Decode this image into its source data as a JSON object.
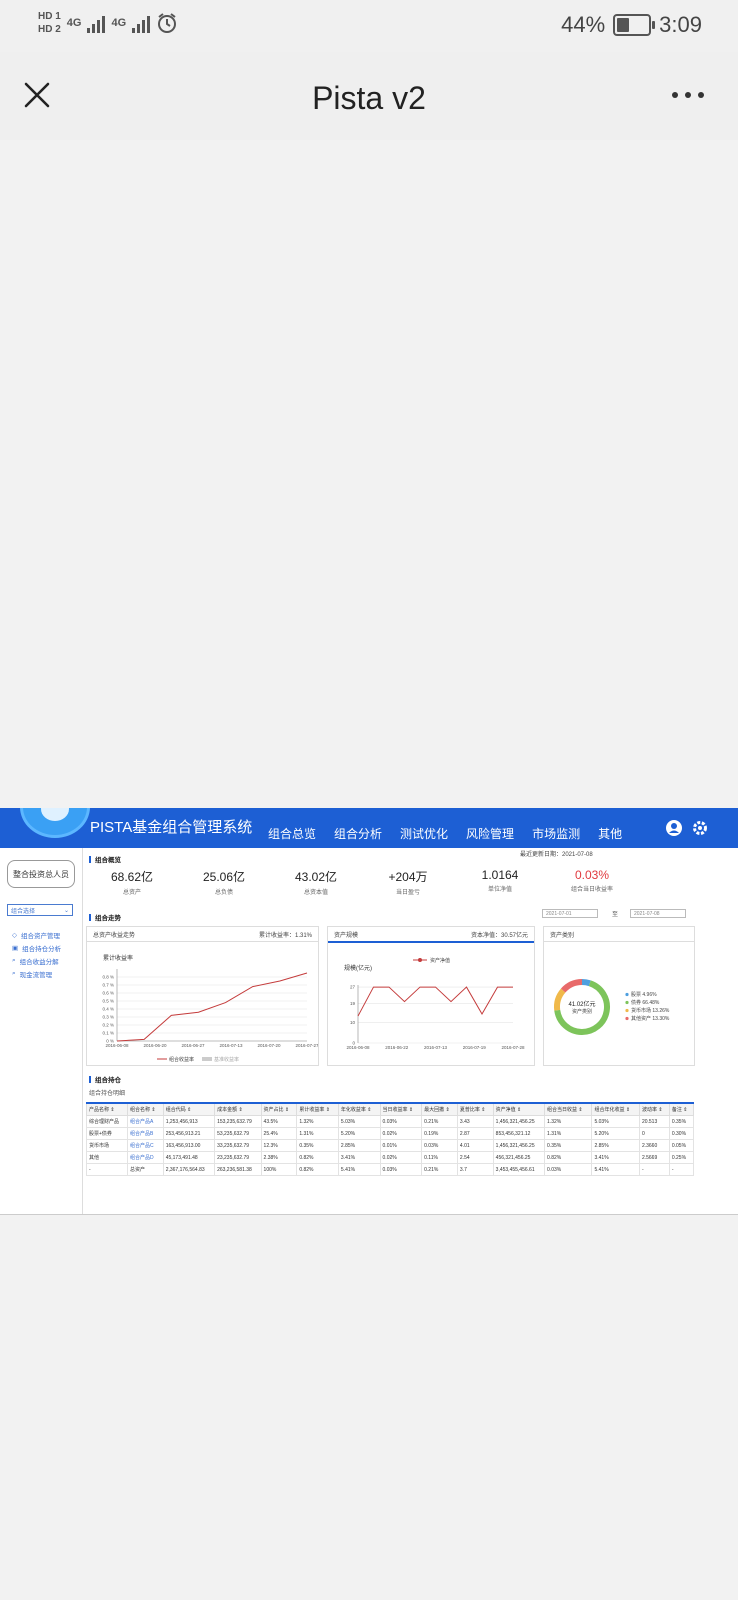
{
  "status_bar": {
    "sim1": "HD 1",
    "sim2": "HD 2",
    "net1": "4G",
    "net2": "4G",
    "battery_text": "44%",
    "battery_level": 0.44,
    "time": "3:09",
    "icons": [
      "signal-icon",
      "alarm-icon",
      "battery-icon"
    ]
  },
  "nav": {
    "title": "Pista v2",
    "close_icon": "close-icon",
    "more_icon": "more-icon"
  },
  "app": {
    "system_title": "PISTA基金组合管理系统",
    "menu": [
      "组合总览",
      "组合分析",
      "测试优化",
      "风险管理",
      "市场监测",
      "其他"
    ],
    "accent": "#1d5fd4",
    "left": {
      "org_button": "整合投资总人员",
      "select": "组合选择",
      "links": [
        "组合资产管理",
        "组合持仓分析",
        "组合收益分解",
        "现金流管理"
      ]
    },
    "overview_title": "组合概览",
    "date_label": "最近更新日期：2021-07-08",
    "kpis": [
      {
        "value": "68.62亿",
        "label": "总资产"
      },
      {
        "value": "25.06亿",
        "label": "总负债"
      },
      {
        "value": "43.02亿",
        "label": "总资本值"
      },
      {
        "value": "+204万",
        "label": "当日盈亏"
      },
      {
        "value": "1.0164",
        "label": "单位净值"
      },
      {
        "value": "0.03%",
        "label": "组合当日收益率"
      }
    ],
    "trend_title": "组合走势",
    "date_from": "2021-07-01",
    "date_sep": "至",
    "date_to": "2021-07-08",
    "panel1": {
      "title": "总资产收益走势",
      "meta": "累计收益率：1.31%",
      "inner_title": "累计收益率",
      "legend": [
        "组合收益率",
        "基准收益率"
      ]
    },
    "panel2": {
      "title": "资产规模",
      "meta": "资本净值：30.57亿元",
      "inner_title": "规模(亿元)",
      "legend": "资产净值"
    },
    "panel3": {
      "title": "资产类别",
      "center_value": "41.02亿元",
      "center_label": "资产类别"
    },
    "holdings_title": "组合持仓",
    "holdings_sub": "组合持仓明细"
  },
  "chart_data": [
    {
      "type": "line",
      "title": "累计收益率",
      "x": [
        "2016-06-08",
        "2016-06-20",
        "2016-06-27",
        "2016-07-13",
        "2016-07-20",
        "2016-07-27"
      ],
      "series": [
        {
          "name": "组合收益率",
          "values": [
            0.0,
            0.02,
            0.32,
            0.36,
            0.48,
            0.68,
            0.75,
            0.85
          ]
        },
        {
          "name": "基准收益率",
          "values": []
        }
      ],
      "ylim": [
        0,
        0.9
      ],
      "yticks": [
        "0 %",
        "0.1 %",
        "0.2 %",
        "0.3 %",
        "0.4 %",
        "0.5 %",
        "0.6 %",
        "0.7 %",
        "0.8 %"
      ]
    },
    {
      "type": "line",
      "title": "规模(亿元)",
      "x": [
        "2016-06-08",
        "2016-06-22",
        "2016-07-13",
        "2016-07-19",
        "2016-07-28"
      ],
      "series": [
        {
          "name": "资产净值",
          "values": [
            13,
            27,
            27,
            20,
            27,
            27,
            20,
            27,
            14,
            27,
            27
          ]
        }
      ],
      "ylim": [
        0,
        28
      ],
      "yticks": [
        "0",
        "10",
        "19",
        "27"
      ]
    },
    {
      "type": "pie",
      "categories": [
        "股票",
        "债券",
        "货币市场",
        "其他资产"
      ],
      "values": [
        4.96,
        66.48,
        13.26,
        13.3
      ],
      "labels": [
        "股票 4.96%",
        "债券 66.48%",
        "货币市场 13.26%",
        "其他资产 13.30%"
      ],
      "colors": [
        "#4e9fdf",
        "#7dc45b",
        "#f0b94a",
        "#e86a6a"
      ]
    }
  ],
  "table": {
    "headers": [
      "产品名称",
      "组合名称",
      "组合代码",
      "成本金额",
      "资产占比",
      "累计收益率",
      "年化收益率",
      "当日收益率",
      "最大回撤",
      "夏普比率",
      "资产净值",
      "组合当日收益",
      "组合年化收益",
      "波动率",
      "备注"
    ],
    "rows": [
      [
        "综合理财产品",
        "组合产品A",
        "1,253,456,913",
        "153,235,632.79",
        "43.5%",
        "1.32%",
        "5.03%",
        "0.03%",
        "0.21%",
        "3.43",
        "1,456,321,456.25",
        "1.32%",
        "5.03%",
        "20.513",
        "0.35%"
      ],
      [
        "股票+债券",
        "组合产品B",
        "253,456,913.21",
        "53,235,632.79",
        "25.4%",
        "1.31%",
        "5.20%",
        "0.02%",
        "0.19%",
        "2.87",
        "853,456,321.12",
        "1.31%",
        "5.20%",
        "0",
        "0.30%"
      ],
      [
        "货币市场",
        "组合产品C",
        "163,456,913.00",
        "33,235,632.79",
        "12.3%",
        "0.35%",
        "2.85%",
        "0.01%",
        "0.03%",
        "4.01",
        "1,456,321,456.25",
        "0.35%",
        "2.85%",
        "2.3660",
        "0.05%"
      ],
      [
        "其他",
        "组合产品D",
        "45,173,491.48",
        "23,235,632.79",
        "2.38%",
        "0.82%",
        "3.41%",
        "0.02%",
        "0.11%",
        "2.54",
        "456,321,456.25",
        "0.82%",
        "3.41%",
        "2.5669",
        "0.25%"
      ],
      [
        "-",
        "总资产",
        "2,367,176,564.83",
        "263,236,581.38",
        "100%",
        "0.82%",
        "5.41%",
        "0.03%",
        "0.21%",
        "3.7",
        "3,453,455,456.61",
        "0.03%",
        "5.41%",
        "-",
        "-"
      ]
    ]
  }
}
